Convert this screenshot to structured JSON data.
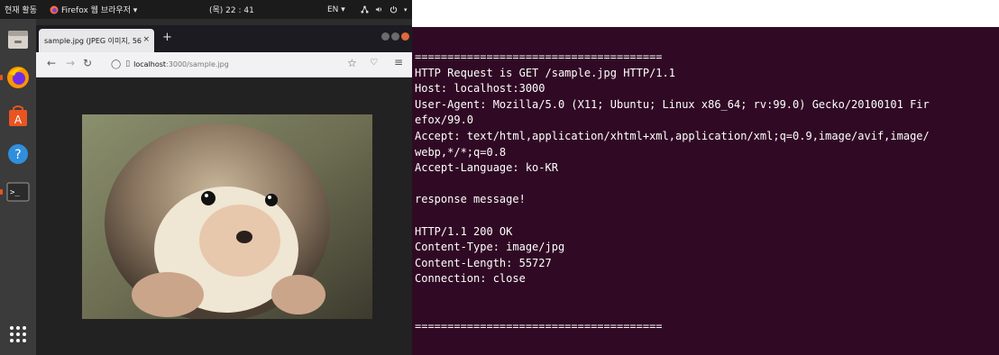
{
  "topbar": {
    "activities": "현재 활동",
    "app_name": "Firefox 웹 브라우저 ▾",
    "clock": "(목) 22 : 41",
    "lang": "EN ▾"
  },
  "dock": {
    "items": [
      {
        "name": "file-manager"
      },
      {
        "name": "firefox",
        "active": true
      },
      {
        "name": "software-center"
      },
      {
        "name": "help"
      },
      {
        "name": "terminal",
        "active": true
      },
      {
        "name": "app-grid"
      }
    ]
  },
  "browser": {
    "tab_title": "sample.jpg (JPEG 이미지, 56",
    "tab_close": "×",
    "new_tab": "+",
    "url_host": "localhost",
    "url_path": ":3000/sample.jpg",
    "image_subject": "hedgehog photo"
  },
  "terminal": {
    "lines": [
      "======================================",
      "HTTP Request is GET /sample.jpg HTTP/1.1",
      "Host: localhost:3000",
      "User-Agent: Mozilla/5.0 (X11; Ubuntu; Linux x86_64; rv:99.0) Gecko/20100101 Fir",
      "efox/99.0",
      "Accept: text/html,application/xhtml+xml,application/xml;q=0.9,image/avif,image/",
      "webp,*/*;q=0.8",
      "Accept-Language: ko-KR",
      "",
      "response message!",
      "",
      "HTTP/1.1 200 OK",
      "Content-Type: image/jpg",
      "Content-Length: 55727",
      "Connection: close",
      "",
      "",
      "======================================"
    ]
  },
  "colors": {
    "terminal_bg": "#300a24",
    "ubuntu_orange": "#e95420",
    "dock_bg": "#3b3b3b"
  }
}
